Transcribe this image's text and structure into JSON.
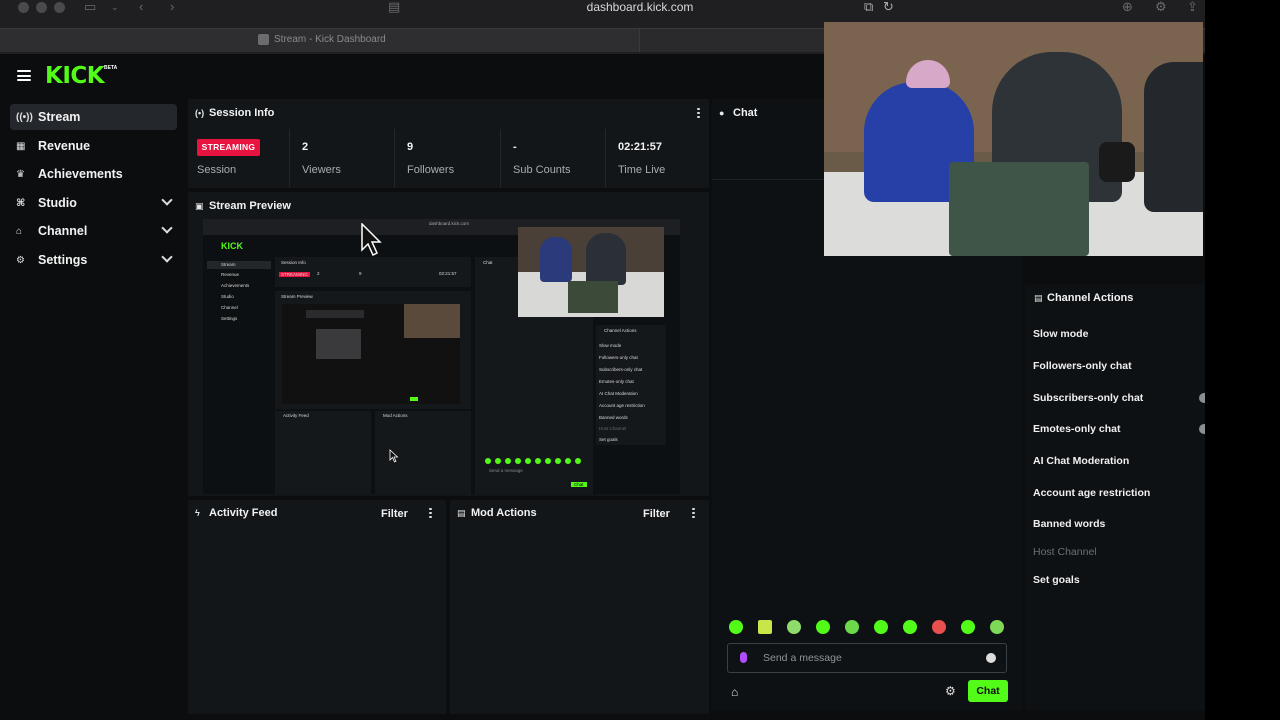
{
  "browser": {
    "url": "dashboard.kick.com",
    "tab_title": "Stream - Kick Dashboard"
  },
  "app": {
    "logo": "KICK",
    "logo_badge": "BETA"
  },
  "sidebar": {
    "items": [
      {
        "label": "Stream",
        "icon": "broadcast-icon",
        "active": true
      },
      {
        "label": "Revenue",
        "icon": "chart-icon"
      },
      {
        "label": "Achievements",
        "icon": "trophy-icon"
      },
      {
        "label": "Studio",
        "icon": "studio-icon",
        "expandable": true
      },
      {
        "label": "Channel",
        "icon": "channel-icon",
        "expandable": true
      },
      {
        "label": "Settings",
        "icon": "gear-icon",
        "expandable": true
      }
    ]
  },
  "session_info": {
    "title": "Session Info",
    "status_badge": "STREAMING",
    "session_label": "Session",
    "stats": [
      {
        "value": "2",
        "label": "Viewers"
      },
      {
        "value": "9",
        "label": "Followers"
      },
      {
        "value": "-",
        "label": "Sub Counts"
      },
      {
        "value": "02:21:57",
        "label": "Time Live"
      }
    ]
  },
  "stream_preview": {
    "title": "Stream Preview"
  },
  "activity_feed": {
    "title": "Activity Feed",
    "filter_label": "Filter"
  },
  "mod_actions": {
    "title": "Mod Actions",
    "filter_label": "Filter"
  },
  "chat": {
    "title": "Chat",
    "input_placeholder": "Send a message",
    "send_label": "Chat"
  },
  "channel_actions": {
    "title": "Channel Actions",
    "items": [
      {
        "label": "Slow mode"
      },
      {
        "label": "Followers-only chat"
      },
      {
        "label": "Subscribers-only chat",
        "has_toggle": true
      },
      {
        "label": "Emotes-only chat",
        "has_toggle": true
      },
      {
        "label": "AI Chat Moderation"
      },
      {
        "label": "Account age restriction"
      },
      {
        "label": "Banned words"
      },
      {
        "label": "Host Channel",
        "disabled": true
      },
      {
        "label": "Set goals"
      }
    ]
  },
  "colors": {
    "brand": "#53fc18",
    "streaming_badge": "#e8143f",
    "background": "#0b0d0f",
    "panel": "#131619"
  }
}
